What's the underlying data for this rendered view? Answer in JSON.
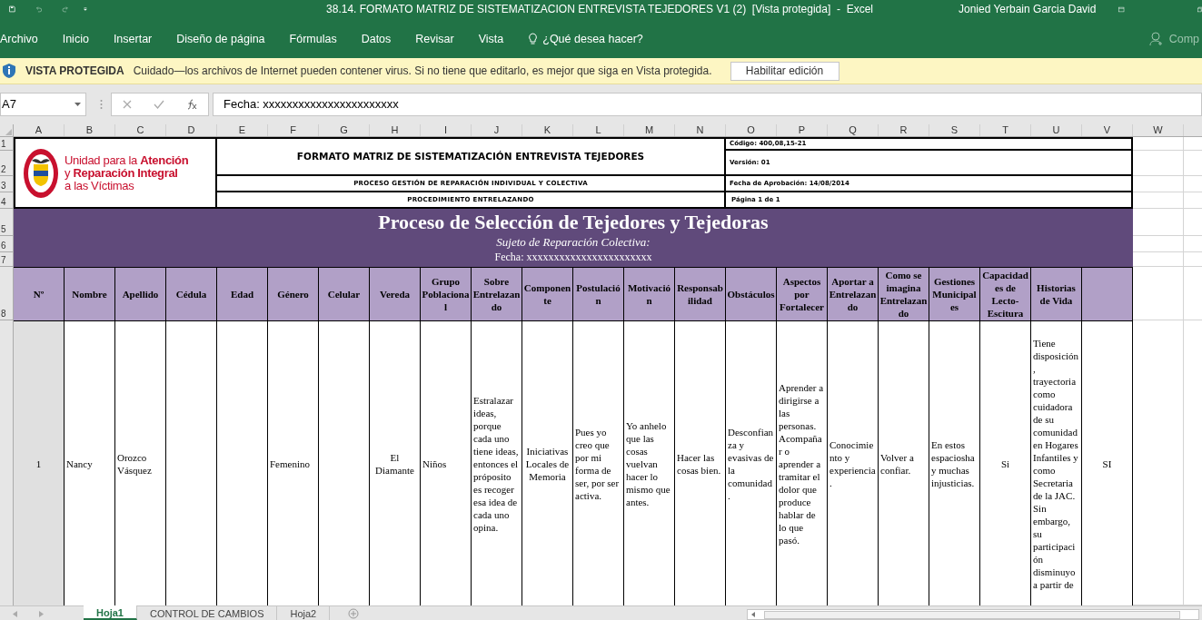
{
  "title_bar": {
    "title": "38.14. FORMATO MATRIZ DE SISTEMATIZACION ENTREVISTA TEJEDORES V1 (2)  [Vista protegida]  -  Excel",
    "user": "Jonied Yerbain Garcia David"
  },
  "ribbon": {
    "tabs": [
      "Archivo",
      "Inicio",
      "Insertar",
      "Diseño de página",
      "Fórmulas",
      "Datos",
      "Revisar",
      "Vista"
    ],
    "tell_me": "¿Qué desea hacer?",
    "share": "Comp"
  },
  "protected_view": {
    "label": "VISTA PROTEGIDA",
    "message": "Cuidado—los archivos de Internet pueden contener virus. Si no tiene que editarlo, es mejor que siga en Vista protegida.",
    "button": "Habilitar edición"
  },
  "formula_bar": {
    "name_box": "A7",
    "formula": "Fecha: xxxxxxxxxxxxxxxxxxxxxxx"
  },
  "column_headers": [
    "A",
    "B",
    "C",
    "D",
    "E",
    "F",
    "G",
    "H",
    "I",
    "J",
    "K",
    "L",
    "M",
    "N",
    "O",
    "P",
    "Q",
    "R",
    "S",
    "T",
    "U",
    "V",
    "W"
  ],
  "row_headers": [
    "1",
    "2",
    "3",
    "4",
    "5",
    "6",
    "7",
    "8"
  ],
  "document_header": {
    "logo_lines": [
      "Unidad para la **Atención**",
      "y **Reparación Integral**",
      "a las Víctimas"
    ],
    "title": "FORMATO MATRIZ DE SISTEMATIZACIÓN ENTREVISTA TEJEDORES",
    "process": "PROCESO GESTIÓN DE REPARACIÓN INDIVIDUAL Y COLECTIVA",
    "procedure": "PROCEDIMIENTO ENTRELAZANDO",
    "code": "Código: 400,08,15-21",
    "version": "Versión: 01",
    "approval_date": "Fecha de Aprobación: 14/08/2014",
    "page": "Página 1 de 1"
  },
  "banner": {
    "title": "Proceso de Selección de Tejedores y Tejedoras",
    "subject": "Sujeto de Reparación Colectiva:",
    "date": "Fecha: xxxxxxxxxxxxxxxxxxxxxxx"
  },
  "table": {
    "columns": [
      "Nº",
      "Nombre",
      "Apellido",
      "Cédula",
      "Edad",
      "Género",
      "Celular",
      "Vereda",
      "Grupo Poblacional",
      "Sobre Entrelazando",
      "Componente",
      "Postulación",
      "Motivación",
      "Responsabilidad",
      "Obstáculos",
      "Aspectos por Fortalecer",
      "Aportar a Entrelazando",
      "Como se imagina Entrelazando",
      "Gestiones Municipales",
      "Capacidades de Lecto-Escitura",
      "Historias de Vida"
    ],
    "rows": [
      {
        "cells": [
          "1",
          "Nancy",
          "Orozco Vásquez",
          null,
          null,
          "Femenino",
          null,
          "El Diamante",
          "Niños",
          "Estralazar ideas, porque cada uno tiene ideas, entonces el próposito es recoger esa idea de cada uno opina.",
          "Iniciativas Locales de Memoria",
          "Pues yo creo que por mi forma de ser, por ser activa.",
          "Yo anhelo que las cosas vuelvan hacer lo mismo que antes.",
          "Hacer las cosas bien.",
          "Desconfianza y evasivas de la comunidad.",
          "Aprender a dirigirse a las personas. Acompañar o aprender a tramitar el dolor que produce hablar de lo que pasó.",
          "Conocimiento y experiencia.",
          "Volver a confiar.",
          "En estos espaciosha y muchas injusticias.",
          "Si",
          "Tiene disposición, trayectoria como cuidadora de su comunidad en Hogares Infantiles y como Secretaria de la JAC. Sin embargo, su participación disminuyo a partir de",
          "SI"
        ]
      }
    ]
  },
  "sheet_tabs": [
    {
      "label": "Hoja1",
      "selected": true
    },
    {
      "label": "CONTROL DE CAMBIOS",
      "selected": false
    },
    {
      "label": "Hoja2",
      "selected": false
    }
  ]
}
